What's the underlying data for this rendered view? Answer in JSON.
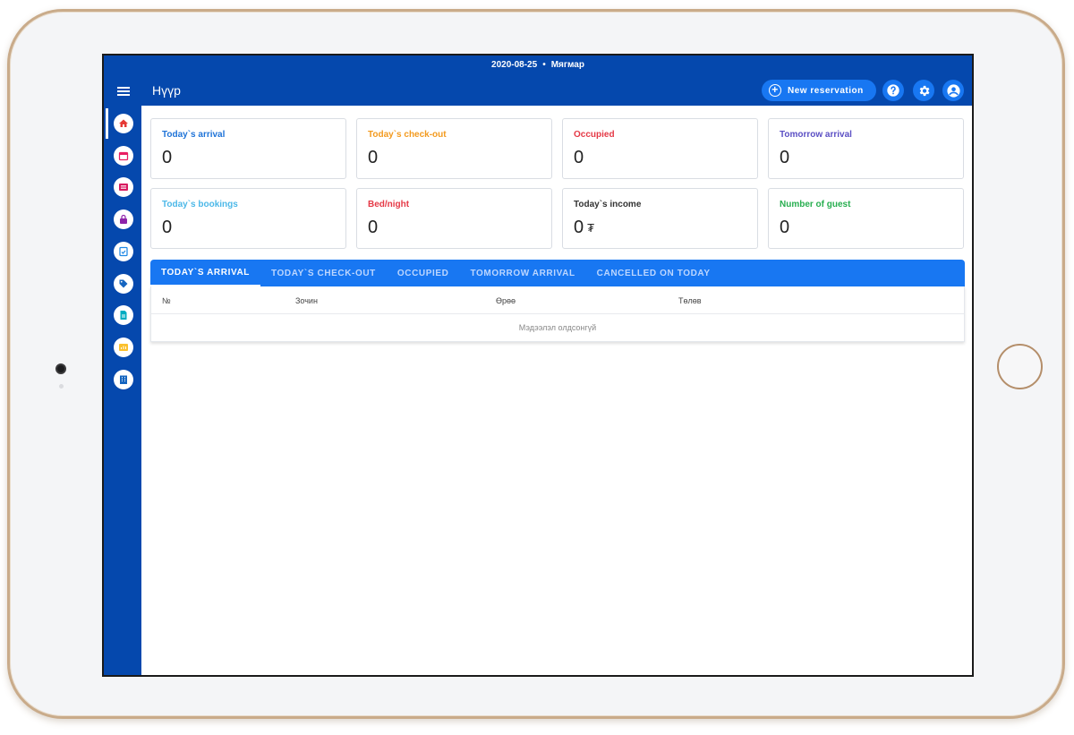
{
  "header": {
    "date": "2020-08-25",
    "separator": "•",
    "weekday": "Мягмар",
    "title": "Нүүр",
    "new_reservation": "New reservation"
  },
  "icons": {
    "menu": "hamburger-icon",
    "help": "help-icon",
    "settings": "gear-icon",
    "account": "account-icon"
  },
  "sidebar": {
    "items": [
      {
        "icon": "home-icon",
        "color": "#e53935"
      },
      {
        "icon": "calendar-icon",
        "color": "#e91e63"
      },
      {
        "icon": "list-icon",
        "color": "#d81b60"
      },
      {
        "icon": "lock-icon",
        "color": "#8e24aa"
      },
      {
        "icon": "checklist-icon",
        "color": "#1e88e5"
      },
      {
        "icon": "tag-icon",
        "color": "#1565c0"
      },
      {
        "icon": "document-icon",
        "color": "#00acc1"
      },
      {
        "icon": "chart-icon",
        "color": "#fbc02d"
      },
      {
        "icon": "building-icon",
        "color": "#1565c0"
      }
    ]
  },
  "cards": [
    {
      "label": "Today`s arrival",
      "value": "0",
      "color": "#1e73d8"
    },
    {
      "label": "Today`s check-out",
      "value": "0",
      "color": "#f39a1e"
    },
    {
      "label": "Occupied",
      "value": "0",
      "color": "#e53946"
    },
    {
      "label": "Tomorrow arrival",
      "value": "0",
      "color": "#5b4fc4"
    },
    {
      "label": "Today`s bookings",
      "value": "0",
      "color": "#4cb8e8"
    },
    {
      "label": "Bed/night",
      "value": "0",
      "color": "#e53946"
    },
    {
      "label": "Today`s income",
      "value": "0",
      "unit": "₮",
      "color": "#333333"
    },
    {
      "label": "Number of guest",
      "value": "0",
      "color": "#27ae4f"
    }
  ],
  "tabs": [
    "Today`s arrival",
    "Today`s check-out",
    "Occupied",
    "Tomorrow arrival",
    "Cancelled on today"
  ],
  "table": {
    "columns": [
      "№",
      "Зочин",
      "Өрөө",
      "Төлөв"
    ],
    "empty_text": "Мэдээлэл олдсонгүй"
  },
  "colors": {
    "primary": "#0548ad",
    "accent": "#1877f2"
  }
}
